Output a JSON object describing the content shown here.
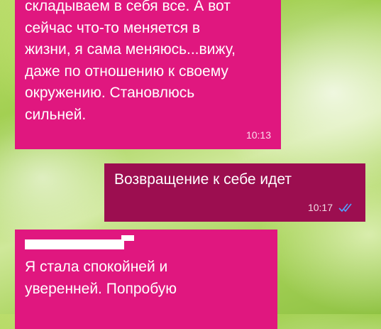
{
  "messages": [
    {
      "direction": "incoming",
      "text": "складываем в себя все. А вот\nсейчас что-то меняется в\nжизни, я сама меняюсь...вижу,\nдаже по отношению к своему\nокружению. Становлюсь\nсильней.",
      "time": "10:13"
    },
    {
      "direction": "outgoing",
      "text": "Возвращение к себе идет",
      "time": "10:17",
      "status_icon": "double-check-icon"
    },
    {
      "direction": "incoming",
      "text": "Я стала спокойней и\nуверенней. Попробую"
    }
  ],
  "colors": {
    "incoming_bubble": "#e0177f",
    "outgoing_bubble": "#9c0e50",
    "read_ticks": "#4fa3ff"
  }
}
